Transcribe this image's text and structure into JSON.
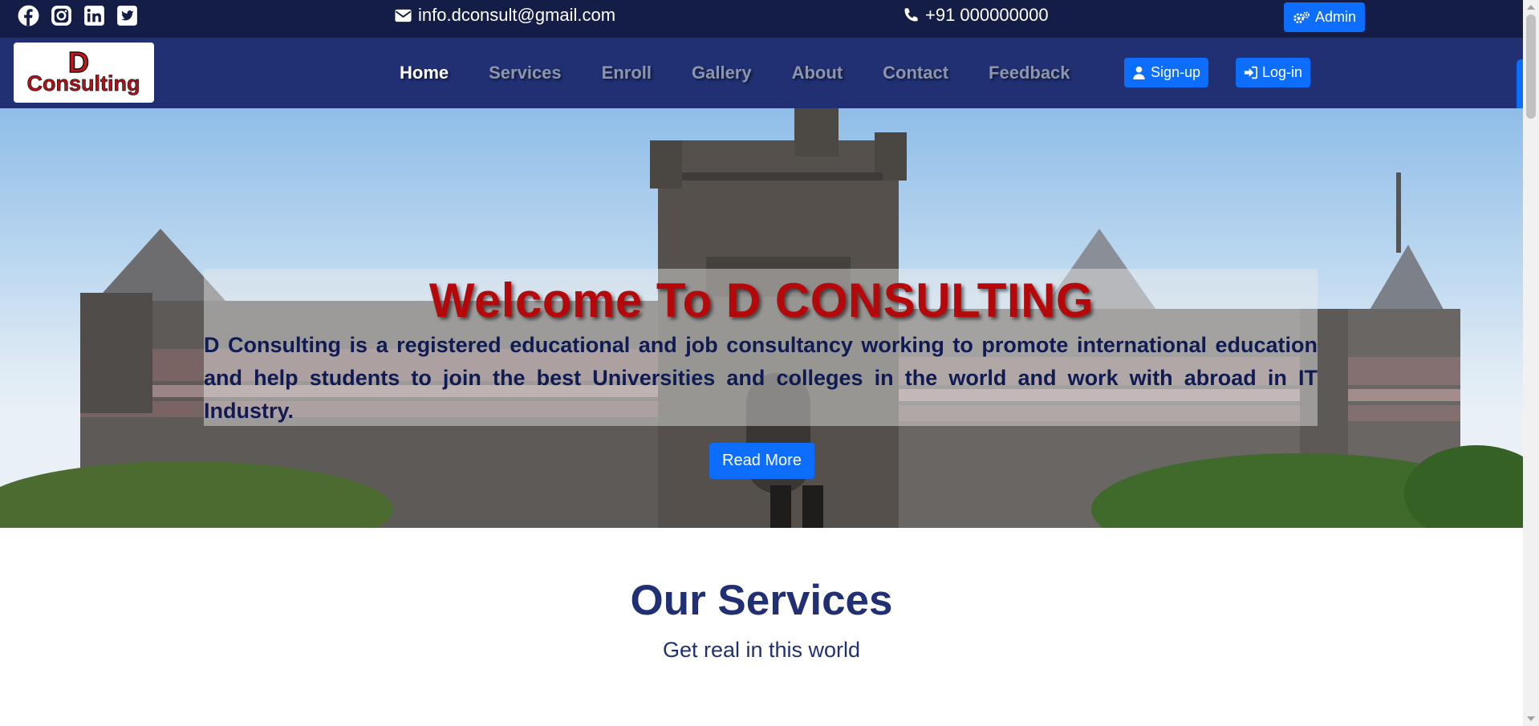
{
  "topbar": {
    "social_icons": [
      "facebook-icon",
      "instagram-icon",
      "linkedin-icon",
      "twitter-icon"
    ],
    "email": "info.dconsult@gmail.com",
    "phone": "+91 000000000",
    "admin_label": "Admin"
  },
  "navbar": {
    "logo_letter": "D",
    "logo_text": "Consulting",
    "links": [
      {
        "label": "Home",
        "active": true
      },
      {
        "label": "Services",
        "active": false
      },
      {
        "label": "Enroll",
        "active": false
      },
      {
        "label": "Gallery",
        "active": false
      },
      {
        "label": "About",
        "active": false
      },
      {
        "label": "Contact",
        "active": false
      },
      {
        "label": "Feedback",
        "active": false
      }
    ],
    "signup_label": "Sign-up",
    "login_label": "Log-in"
  },
  "hero": {
    "title": "Welcome To D CONSULTING",
    "text": " D Consulting is a registered educational and job consultancy working to promote international education and help students to join the best Universities and colleges in the world and work with abroad in IT Industry.",
    "button_label": "Read More"
  },
  "services": {
    "title": "Our Services",
    "subtitle": "Get real in this world"
  },
  "colors": {
    "topbar_bg": "#141d45",
    "navbar_bg": "#203073",
    "accent": "#0d6efd",
    "hero_title": "#b5080b",
    "heading": "#203073"
  }
}
